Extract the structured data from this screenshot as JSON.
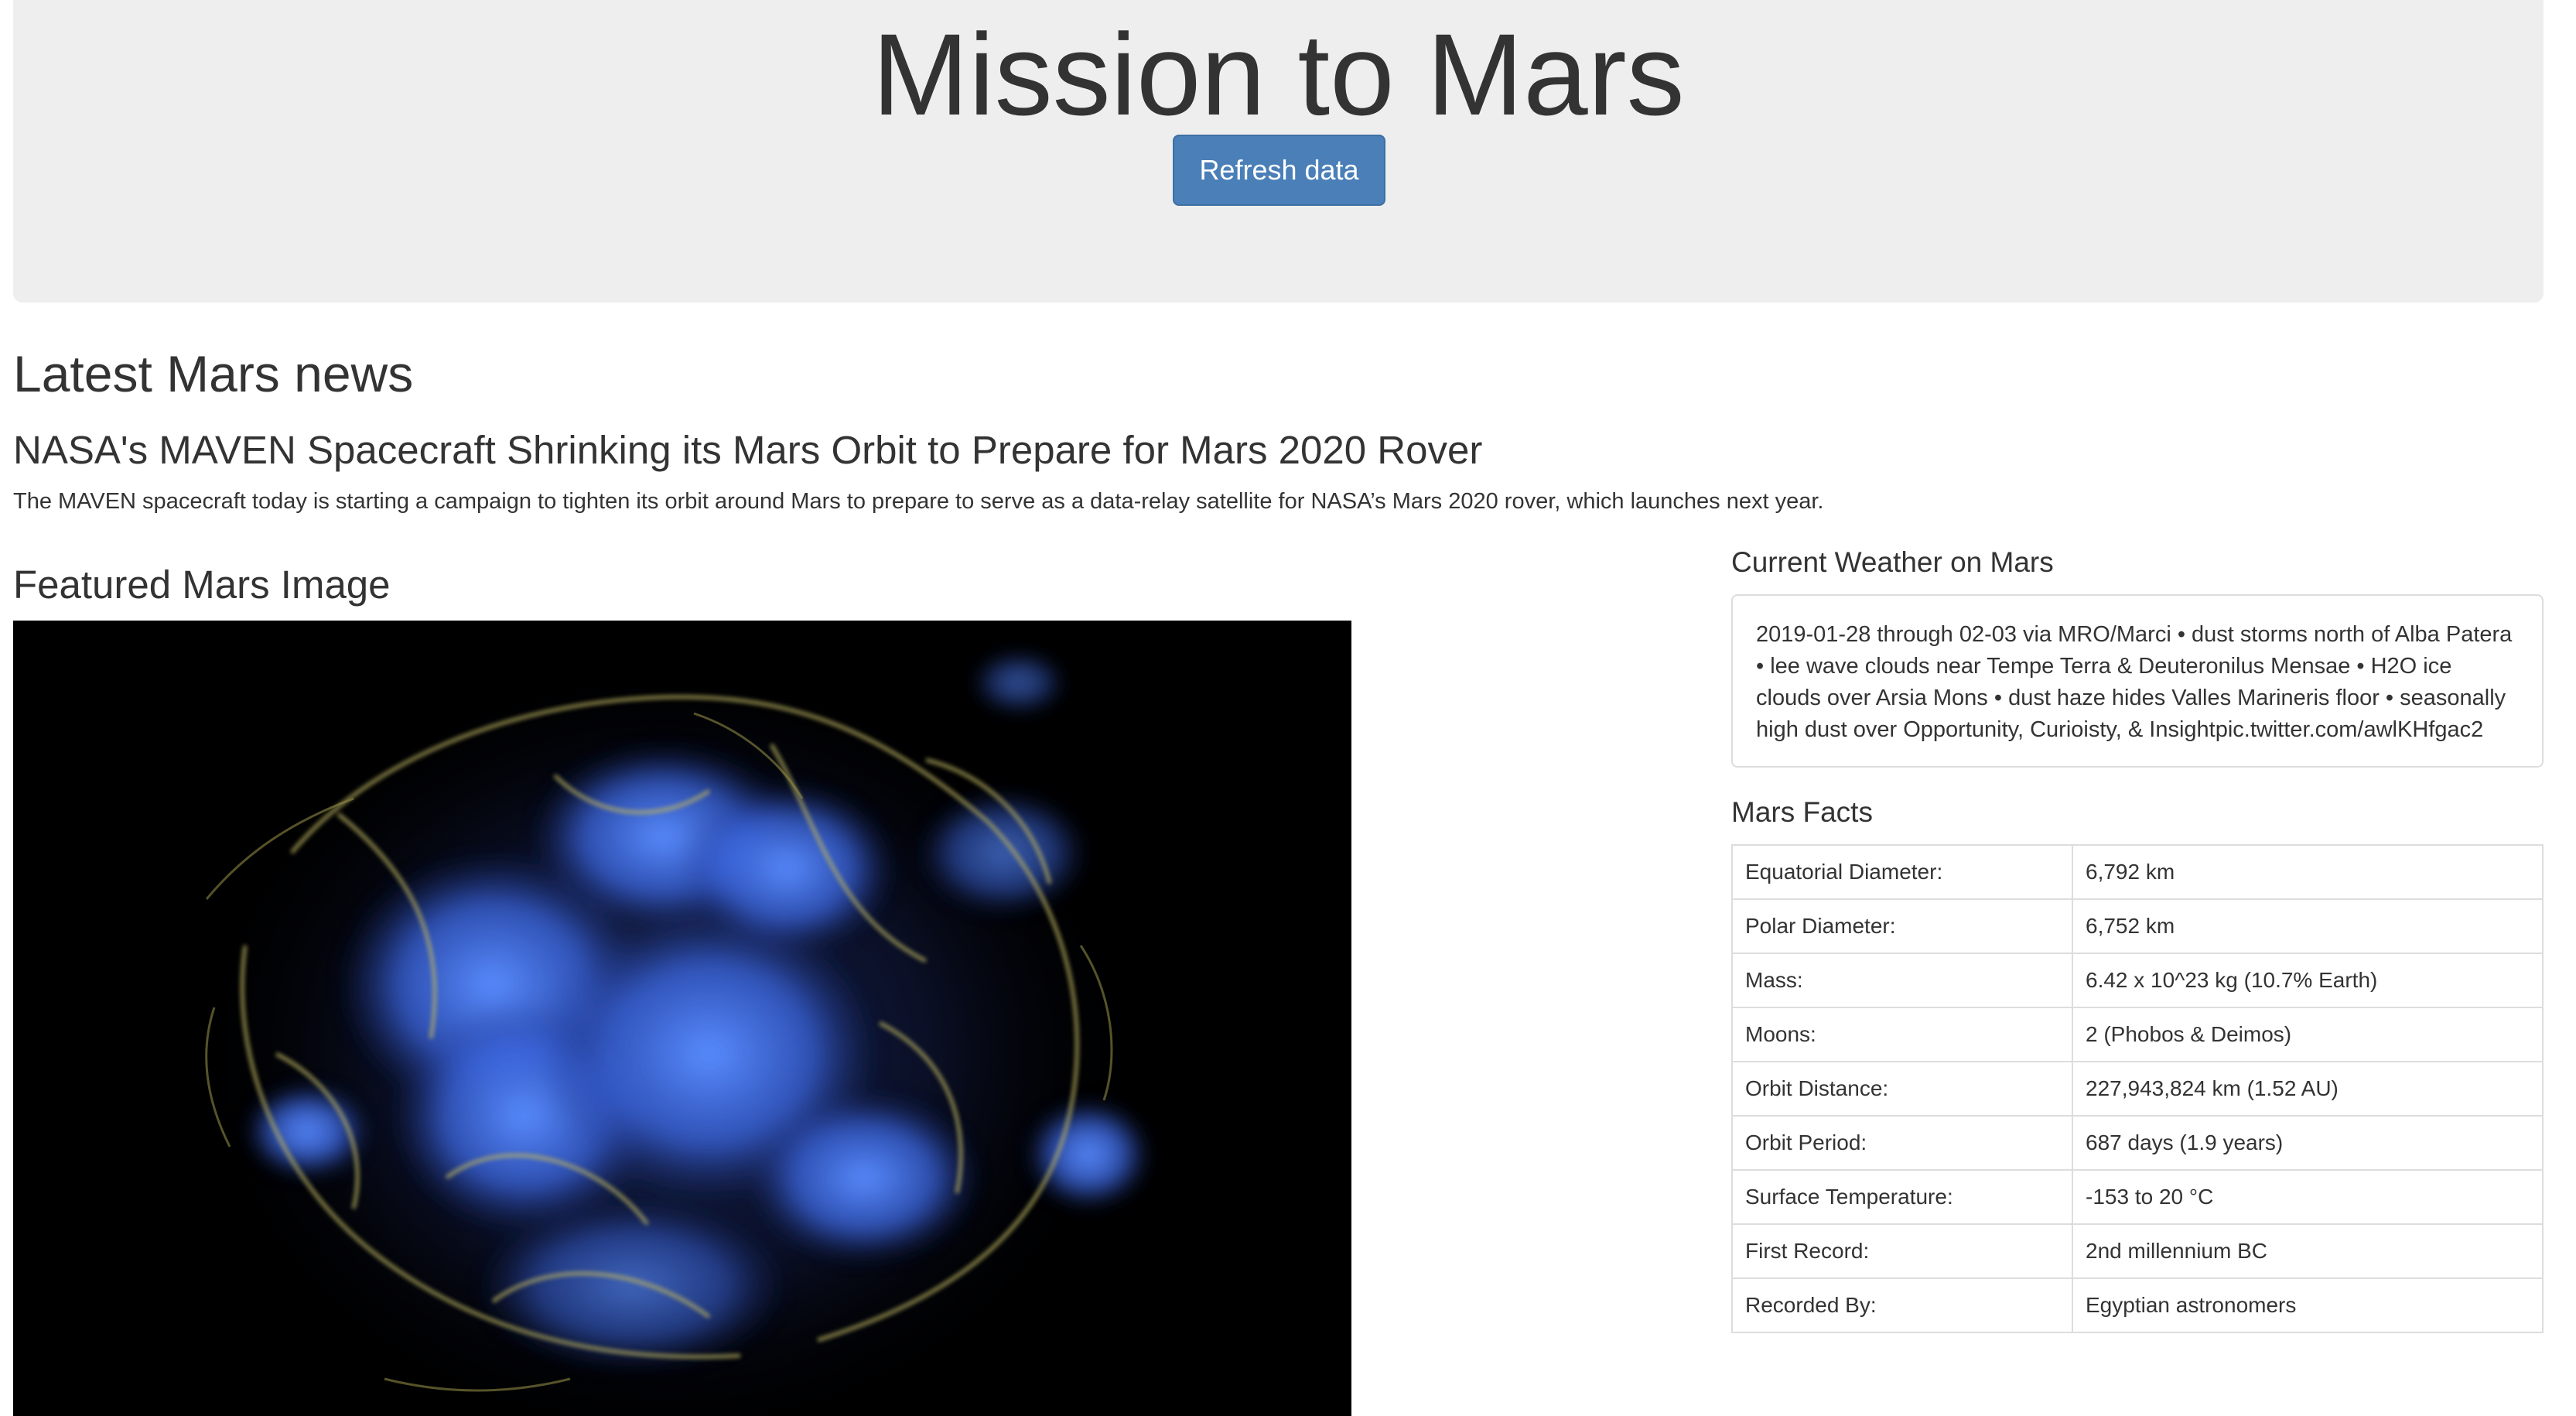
{
  "header": {
    "title": "Mission to Mars",
    "refresh_label": "Refresh data"
  },
  "news": {
    "section_heading": "Latest Mars news",
    "title": "NASA's MAVEN Spacecraft Shrinking its Mars Orbit to Prepare for Mars 2020 Rover",
    "paragraph": "The MAVEN spacecraft today is starting a campaign to tighten its orbit around Mars to prepare to serve as a data-relay satellite for NASA’s Mars 2020 rover, which launches next year."
  },
  "featured_image": {
    "heading": "Featured Mars Image"
  },
  "weather": {
    "heading": "Current Weather on Mars",
    "text": "2019-01-28 through 02-03 via MRO/Marci • dust storms north of Alba Patera • lee wave clouds near Tempe Terra & Deuteronilus Mensae • H2O ice clouds over Arsia Mons • dust haze hides Valles Marineris floor • seasonally high dust over Opportunity, Curioisty, & Insightpic.twitter.com/awlKHfgac2"
  },
  "facts": {
    "heading": "Mars Facts",
    "rows": [
      {
        "label": "Equatorial Diameter:",
        "value": "6,792 km"
      },
      {
        "label": "Polar Diameter:",
        "value": "6,752 km"
      },
      {
        "label": "Mass:",
        "value": "6.42 x 10^23 kg (10.7% Earth)"
      },
      {
        "label": "Moons:",
        "value": "2 (Phobos & Deimos)"
      },
      {
        "label": "Orbit Distance:",
        "value": "227,943,824 km (1.52 AU)"
      },
      {
        "label": "Orbit Period:",
        "value": "687 days (1.9 years)"
      },
      {
        "label": "Surface Temperature:",
        "value": "-153 to 20 °C"
      },
      {
        "label": "First Record:",
        "value": "2nd millennium BC"
      },
      {
        "label": "Recorded By:",
        "value": "Egyptian astronomers"
      }
    ]
  }
}
